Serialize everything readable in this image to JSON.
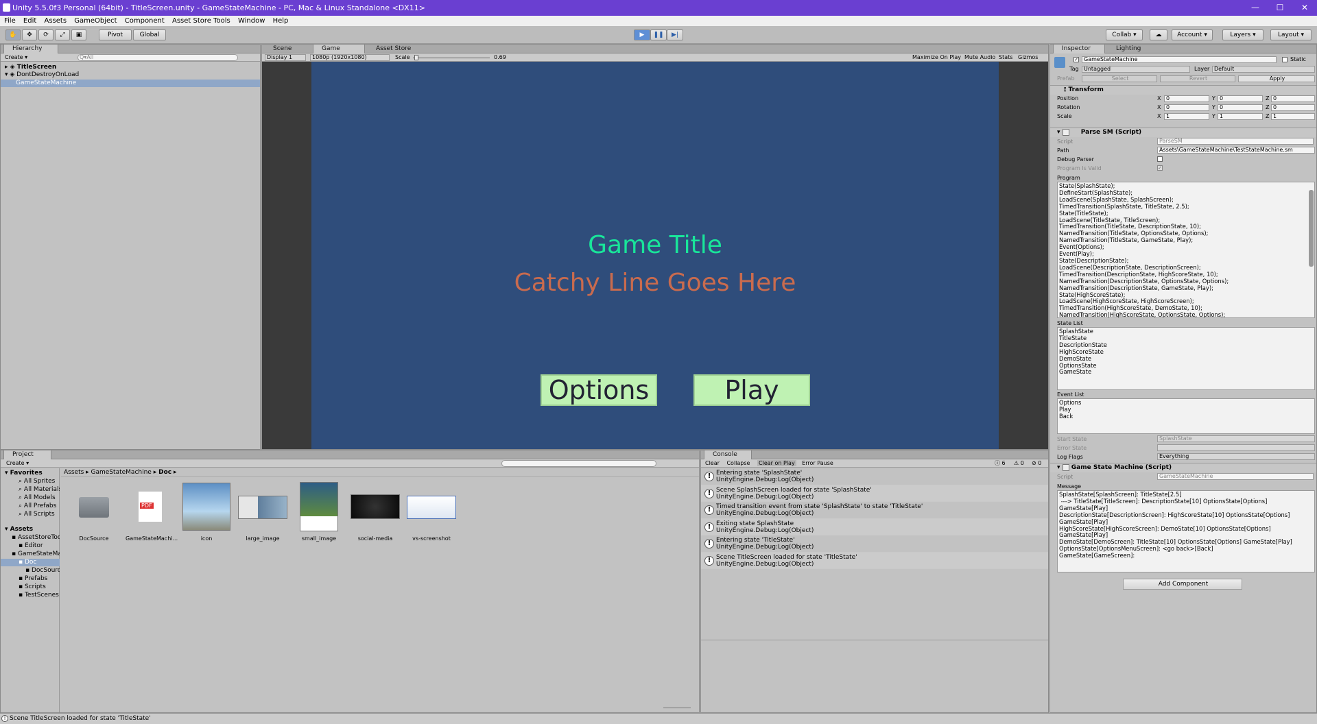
{
  "window": {
    "title": "Unity 5.5.0f3 Personal (64bit) - TitleScreen.unity - GameStateMachine - PC, Mac & Linux Standalone <DX11>",
    "minimize": "—",
    "maximize": "☐",
    "close": "✕"
  },
  "menu": [
    "File",
    "Edit",
    "Assets",
    "GameObject",
    "Component",
    "Asset Store Tools",
    "Window",
    "Help"
  ],
  "toolbar": {
    "pivot": "Pivot",
    "global": "Global",
    "collab": "Collab ▾",
    "account": "Account",
    "layers": "Layers",
    "layout": "Layout"
  },
  "hierarchy": {
    "tab": "Hierarchy",
    "create": "Create",
    "search_placeholder": "Q▾All",
    "items": [
      "TitleScreen",
      "DontDestroyOnLoad",
      "GameStateMachine"
    ]
  },
  "game_view": {
    "tabs": [
      "Scene",
      "Game",
      "Asset Store"
    ],
    "display": "Display 1",
    "resolution": "1080p (1920x1080)",
    "scale_label": "Scale",
    "scale_value": "0.69",
    "scale_fraction": 0.69,
    "options": [
      "Maximize On Play",
      "Mute Audio",
      "Stats",
      "Gizmos"
    ],
    "title_text": "Game Title",
    "catchy_line": "Catchy Line Goes Here",
    "options_button": "Options",
    "play_button": "Play",
    "colors": {
      "background": "#2f4d7b",
      "title": "#19e59a",
      "catchy": "#c96b4e",
      "button": "#bff2b3"
    }
  },
  "inspector": {
    "tabs": [
      "Inspector",
      "Lighting"
    ],
    "object_name": "GameStateMachine",
    "static_label": "Static",
    "tag_label": "Tag",
    "tag_value": "Untagged",
    "layer_label": "Layer",
    "layer_value": "Default",
    "prefab_label": "Prefab",
    "prefab_select": "Select",
    "prefab_revert": "Revert",
    "prefab_apply": "Apply",
    "transform": {
      "title": "Transform",
      "rows": [
        {
          "label": "Position",
          "x": "0",
          "y": "0",
          "z": "0"
        },
        {
          "label": "Rotation",
          "x": "0",
          "y": "0",
          "z": "0"
        },
        {
          "label": "Scale",
          "x": "1",
          "y": "1",
          "z": "1"
        }
      ]
    },
    "parse_sm": {
      "title": "Parse SM (Script)",
      "script_label": "Script",
      "script_value": "ParseSM",
      "path_label": "Path",
      "path_value": "Assets\\GameStateMachine\\TestStateMachine.sm",
      "debug_parser_label": "Debug Parser",
      "program_valid_label": "Program Is Valid",
      "program_label": "Program",
      "program": "State(SplashState);\nDefineStart(SplashState);\nLoadScene(SplashState, SplashScreen);\nTimedTransition(SplashState, TitleState, 2.5);\nState(TitleState);\nLoadScene(TitleState, TitleScreen);\nTimedTransition(TitleState, DescriptionState, 10);\nNamedTransition(TitleState, OptionsState, Options);\nNamedTransition(TitleState, GameState, Play);\nEvent(Options);\nEvent(Play);\nState(DescriptionState);\nLoadScene(DescriptionState, DescriptionScreen);\nTimedTransition(DescriptionState, HighScoreState, 10);\nNamedTransition(DescriptionState, OptionsState, Options);\nNamedTransition(DescriptionState, GameState, Play);\nState(HighScoreState);\nLoadScene(HighScoreState, HighScoreScreen);\nTimedTransition(HighScoreState, DemoState, 10);\nNamedTransition(HighScoreState, OptionsState, Options);",
      "state_list_label": "State List",
      "state_list": "SplashState\nTitleState\nDescriptionState\nHighScoreState\nDemoState\nOptionsState\nGameState",
      "event_list_label": "Event List",
      "event_list": "Options\nPlay\nBack",
      "start_state_label": "Start State",
      "start_state_value": "SplashState",
      "error_state_label": "Error State",
      "log_flags_label": "Log Flags",
      "log_flags_value": "Everything"
    },
    "gsm": {
      "title": "Game State Machine (Script)",
      "script_label": "Script",
      "script_value": "GameStateMachine",
      "message_label": "Message",
      "message": "SplashState[SplashScreen]: TitleState[2.5]\n ---> TitleState[TitleScreen]: DescriptionState[10] OptionsState[Options]\nGameState[Play]\nDescriptionState[DescriptionScreen]: HighScoreState[10] OptionsState[Options]\nGameState[Play]\nHighScoreState[HighScoreScreen]: DemoState[10] OptionsState[Options]\nGameState[Play]\nDemoState[DemoScreen]: TitleState[10] OptionsState[Options] GameState[Play]\nOptionsState[OptionsMenuScreen]: <go back>[Back]\nGameState[GameScreen]:"
    },
    "add_component": "Add Component"
  },
  "project": {
    "tab": "Project",
    "create": "Create",
    "breadcrumb": [
      "Assets",
      "GameStateMachine",
      "Doc"
    ],
    "favorites_label": "Favorites",
    "favorites": [
      "All Sprites",
      "All Materials",
      "All Models",
      "All Prefabs",
      "All Scripts"
    ],
    "assets_label": "Assets",
    "tree": [
      "AssetStoreTools",
      "Editor",
      "GameStateMachine",
      "Doc",
      "DocSource",
      "Prefabs",
      "Scripts",
      "TestScenes"
    ],
    "files": [
      "DocSource",
      "GameStateMachi...",
      "icon",
      "large_image",
      "small_image",
      "social-media",
      "vs-screenshot"
    ],
    "pdf_badge": "PDF"
  },
  "console": {
    "tab": "Console",
    "buttons": [
      "Clear",
      "Collapse",
      "Clear on Play",
      "Error Pause"
    ],
    "counts": {
      "info": "6",
      "warn": "0",
      "error": "0"
    },
    "entries": [
      {
        "line1": "Entering state 'SplashState'",
        "line2": "UnityEngine.Debug:Log(Object)"
      },
      {
        "line1": "Scene SplashScreen loaded for state 'SplashState'",
        "line2": "UnityEngine.Debug:Log(Object)"
      },
      {
        "line1": "Timed transition event from state 'SplashState' to state 'TitleState'",
        "line2": "UnityEngine.Debug:Log(Object)"
      },
      {
        "line1": "Exiting state SplashState",
        "line2": "UnityEngine.Debug:Log(Object)"
      },
      {
        "line1": "Entering state 'TitleState'",
        "line2": "UnityEngine.Debug:Log(Object)"
      },
      {
        "line1": "Scene TitleScreen loaded for state 'TitleState'",
        "line2": "UnityEngine.Debug:Log(Object)"
      }
    ]
  },
  "status": "Scene TitleScreen loaded for state 'TitleState'"
}
